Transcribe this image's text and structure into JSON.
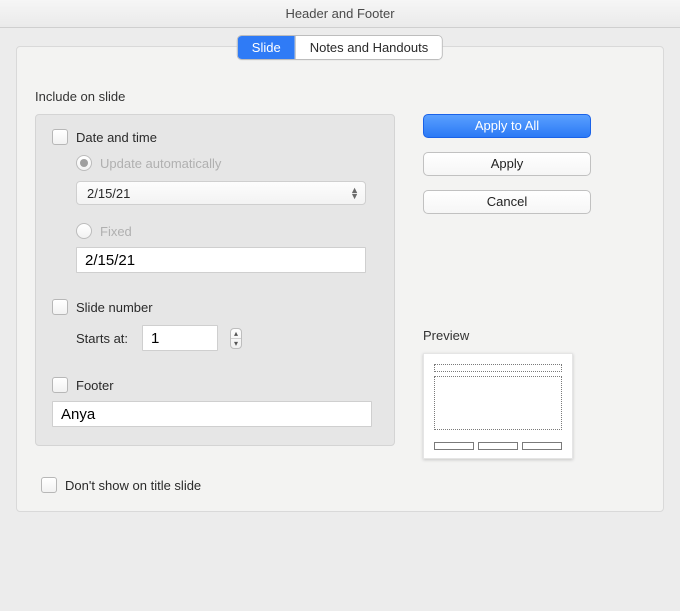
{
  "window": {
    "title": "Header and Footer"
  },
  "tabs": {
    "slide": "Slide",
    "notes": "Notes and Handouts"
  },
  "section": {
    "include": "Include on slide"
  },
  "datetime": {
    "label": "Date and time",
    "auto_label": "Update automatically",
    "auto_value": "2/15/21",
    "fixed_label": "Fixed",
    "fixed_value": "2/15/21"
  },
  "slidenum": {
    "label": "Slide number",
    "starts_label": "Starts at:",
    "starts_value": "1"
  },
  "footer": {
    "label": "Footer",
    "value": "Anya"
  },
  "dont_show": {
    "label": "Don't show on title slide"
  },
  "buttons": {
    "apply_all": "Apply to All",
    "apply": "Apply",
    "cancel": "Cancel"
  },
  "preview": {
    "label": "Preview"
  }
}
